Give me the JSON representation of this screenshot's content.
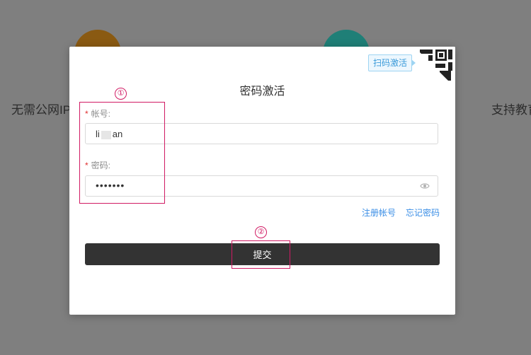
{
  "background": {
    "left_text": "无需公网IP",
    "right_text": "支持教育"
  },
  "dialog": {
    "title": "密码激活",
    "qr_tag": "扫码激活",
    "username": {
      "required_mark": "*",
      "label": "帐号:",
      "value_prefix": "li",
      "value_suffix": "an"
    },
    "password": {
      "required_mark": "*",
      "label": "密码:",
      "value": "•••••••"
    },
    "links": {
      "register": "注册帐号",
      "forgot": "忘记密码"
    },
    "submit_label": "提交"
  },
  "annotations": {
    "one": "①",
    "two": "②"
  },
  "colors": {
    "overlay": "#7f7f7f",
    "link": "#3a8ee6",
    "submit_bg": "#333333",
    "annotation": "#d11a63",
    "required": "#e03030"
  }
}
